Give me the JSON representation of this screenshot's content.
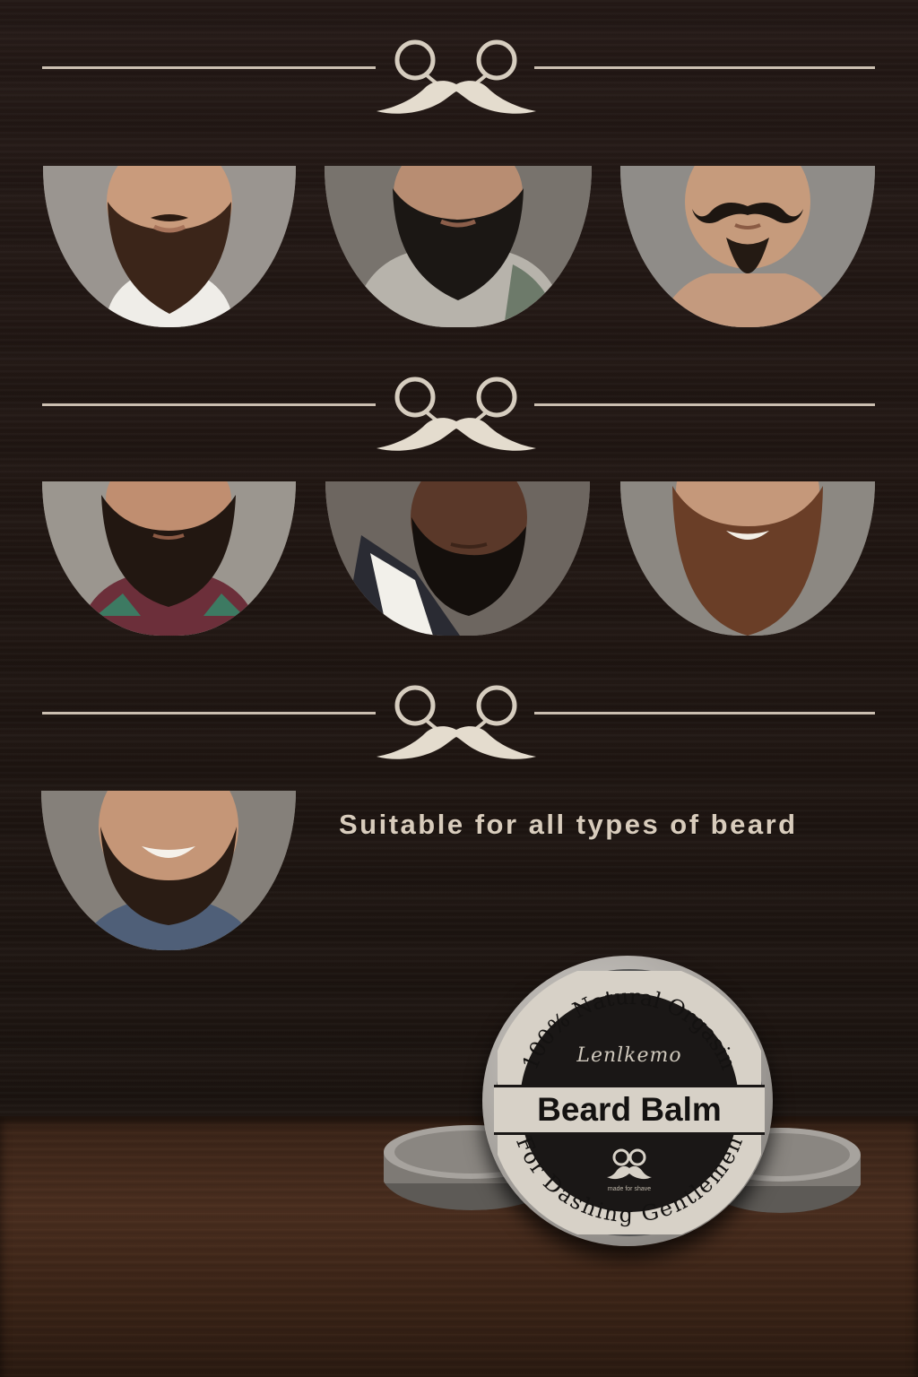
{
  "tagline": "Suitable for all types of beard",
  "product": {
    "name": "Beard Balm",
    "brand": "Lenlkemo",
    "ring_top": "100% Natural Orgasin",
    "ring_bottom": "For Dashing Gentlemen",
    "fine_print": "made for shave"
  },
  "portraits": [
    {
      "id": "beard-portrait-1",
      "beard": "full brown beard",
      "shirt": "white t-shirt"
    },
    {
      "id": "beard-portrait-2",
      "beard": "thick dark beard",
      "shirt": "knit sweater"
    },
    {
      "id": "beard-portrait-3",
      "beard": "curled moustache and goatee",
      "shirt": "bare neck"
    },
    {
      "id": "beard-portrait-4",
      "beard": "full dark beard",
      "shirt": "floral shirt"
    },
    {
      "id": "beard-portrait-5",
      "beard": "full black beard",
      "shirt": "suit jacket"
    },
    {
      "id": "beard-portrait-6",
      "beard": "long reddish beard",
      "shirt": "none visible"
    },
    {
      "id": "beard-portrait-7",
      "beard": "short trimmed beard",
      "shirt": "blue shirt"
    }
  ],
  "colors": {
    "line": "#cbbfb1",
    "text": "#d8ccbc",
    "wood_dark": "#201612",
    "tin_label": "#d7d1c7"
  }
}
